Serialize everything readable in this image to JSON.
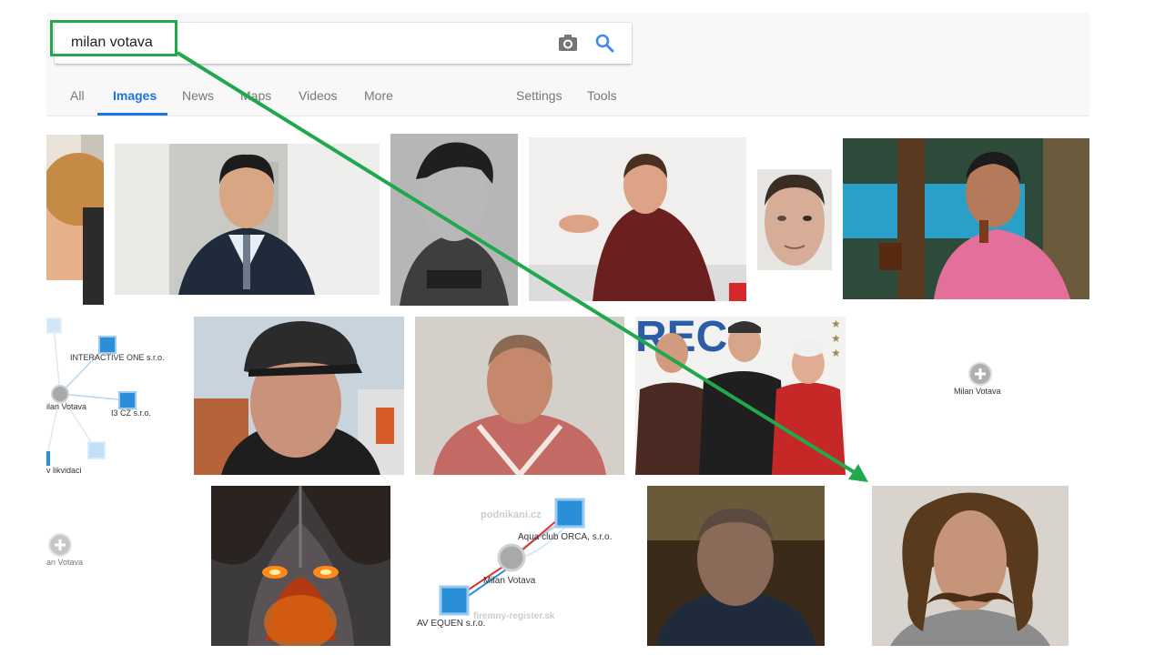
{
  "search": {
    "query": "milan votava"
  },
  "tabs": [
    {
      "label": "All"
    },
    {
      "label": "Images"
    },
    {
      "label": "News"
    },
    {
      "label": "Maps"
    },
    {
      "label": "Videos"
    },
    {
      "label": "More"
    }
  ],
  "tools": {
    "settings": "Settings",
    "tools": "Tools"
  },
  "graph1": {
    "node_a": "INTERACTIVE ONE s.r.o.",
    "node_b": "ilan Votava",
    "node_c": "I3 CZ s.r.o.",
    "node_d": "v likvidaci"
  },
  "graph2": {
    "center": "Milan Votava"
  },
  "graph3": {
    "partial": "an Votava"
  },
  "graph4": {
    "watermark_top": "podnikani.cz",
    "node_top": "Aqua club ORCA, s.r.o.",
    "center": "Milan Votava",
    "node_bottom": "AV EQUEN s.r.o.",
    "watermark_bottom": "firemny-register.sk"
  },
  "colors": {
    "accent": "#1a73e8",
    "annotation": "#20a84d",
    "node_blue": "#2a8fd8"
  }
}
